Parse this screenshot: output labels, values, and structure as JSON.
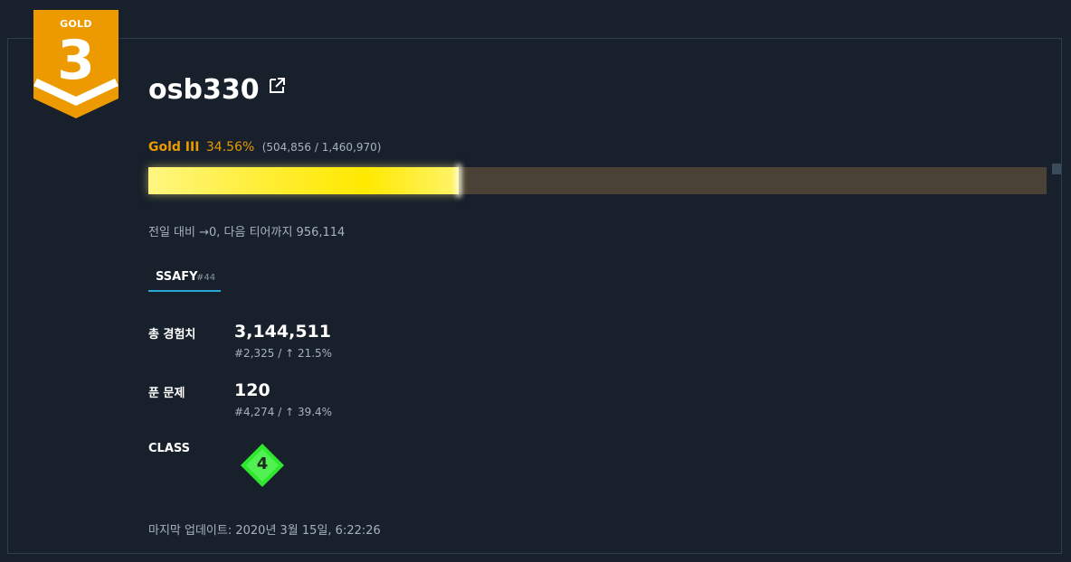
{
  "badge": {
    "tier": "GOLD",
    "level": "3",
    "color": "#ec9a00"
  },
  "profile": {
    "username": "osb330",
    "external_link_icon": "external-link-icon"
  },
  "progress": {
    "tier_name": "Gold III",
    "percent_text": "34.56%",
    "exp_text": "(504,856 / 1,460,970)",
    "fraction": 0.3456,
    "bar_fill_color": "#ffee3a",
    "bar_track_color": "#4a4236"
  },
  "delta_text": "전일 대비 →0, 다음 티어까지 956,114",
  "tabs": [
    {
      "label": "SSAFY",
      "rank": "#44",
      "active": true,
      "underline_color": "#29a8d6"
    }
  ],
  "stats": {
    "total_exp": {
      "label": "총 경험치",
      "value": "3,144,511",
      "sub": "#2,325 / ↑ 21.5%"
    },
    "solved": {
      "label": "푼 문제",
      "value": "120",
      "sub": "#4,274 / ↑ 39.4%"
    },
    "class": {
      "label": "CLASS",
      "value": "4",
      "gem_color": "#2ee82e"
    }
  },
  "updated_text": "마지막 업데이트: 2020년 3월 15일, 6:22:26"
}
